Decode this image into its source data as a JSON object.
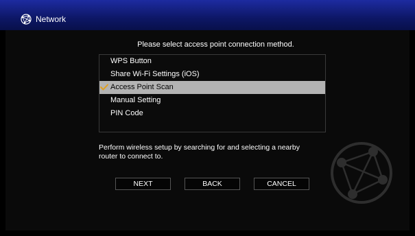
{
  "window": {
    "title": "Network",
    "title_icon": "network-globe-icon"
  },
  "instruction": "Please select access point connection method.",
  "methods": [
    {
      "label": "WPS Button",
      "selected": false
    },
    {
      "label": "Share Wi-Fi Settings (iOS)",
      "selected": false
    },
    {
      "label": "Access Point Scan",
      "selected": true
    },
    {
      "label": "Manual Setting",
      "selected": false
    },
    {
      "label": "PIN Code",
      "selected": false
    }
  ],
  "description": "Perform wireless setup by searching for and selecting a nearby router to connect to.",
  "buttons": {
    "next": "NEXT",
    "back": "BACK",
    "cancel": "CANCEL"
  },
  "colors": {
    "title_bar": "#1d2ba0",
    "selection": "#b3b3b3",
    "check": "#e0a020"
  }
}
